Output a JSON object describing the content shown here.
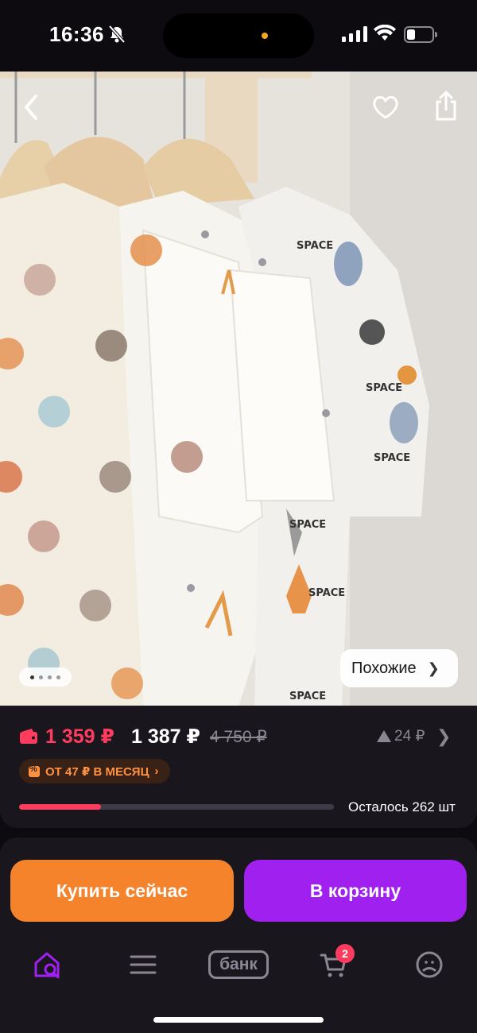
{
  "status_bar": {
    "time": "16:36"
  },
  "product": {
    "photo_alt": "",
    "pager": {
      "count": 4,
      "active": 1
    },
    "similar_label": "Похожие"
  },
  "price": {
    "bank_price": "1 359 ₽",
    "price": "1 387 ₽",
    "old_price": "4 750 ₽",
    "price_increase": "24 ₽",
    "installment": "ОТ 47 ₽ В МЕСЯЦ",
    "stock_text": "Осталось 262 шт",
    "stock_fraction": 0.26
  },
  "actions": {
    "buy_now": "Купить сейчас",
    "add_to_cart": "В корзину"
  },
  "tabbar": {
    "bank_label": "банк",
    "cart_badge": "2"
  },
  "colors": {
    "accent_orange": "#f5832b",
    "accent_purple": "#a020f0",
    "price_red": "#ff3b5e",
    "background": "#1a161e"
  }
}
